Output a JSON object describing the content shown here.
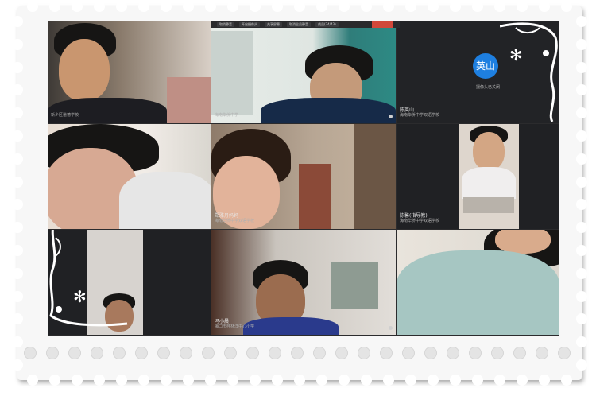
{
  "toolbar": {
    "items": [
      "取消静音",
      "开启摄像头",
      "共享屏幕",
      "取消全员静音",
      "成员(34/43)"
    ]
  },
  "tiles": [
    {
      "name": "",
      "school": "新乡区道德学校"
    },
    {
      "name": "",
      "school": "海南华侨中学"
    },
    {
      "name": "陈英山",
      "school": "海南华侨中学双语学校",
      "avatar_text": "英山",
      "status": "摄像头已关闭"
    },
    {
      "name": "",
      "school": ""
    },
    {
      "name": "郑雅丹妈妈",
      "school": "海南华侨中学双语学校"
    },
    {
      "name": "陈馨(指导教)",
      "school": "海南华侨中学双语学校"
    },
    {
      "name": "",
      "school": ""
    },
    {
      "name": "冯小晨",
      "school": "海口市桂林洋中心小学"
    },
    {
      "name": "",
      "school": ""
    }
  ],
  "colors": {
    "accent": "#1e7fe0",
    "stop_button": "#d2483a",
    "background": "#2b2b2d"
  },
  "icons": [
    "mic-icon",
    "flower-ornament-icon",
    "avatar-icon"
  ]
}
